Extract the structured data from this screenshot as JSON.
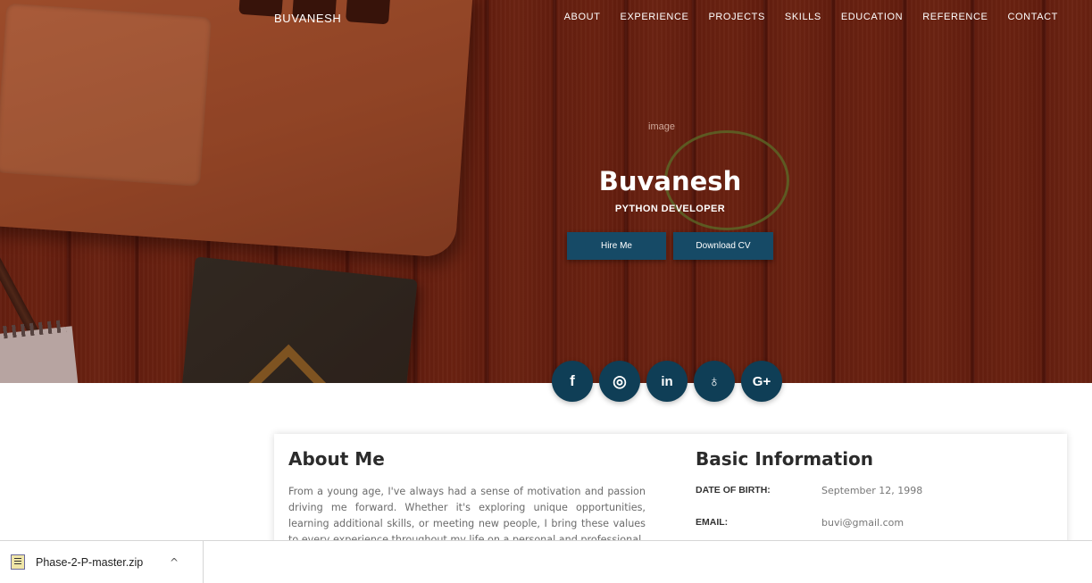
{
  "brand": "BUVANESH",
  "nav": [
    "ABOUT",
    "EXPERIENCE",
    "PROJECTS",
    "SKILLS",
    "EDUCATION",
    "REFERENCE",
    "CONTACT"
  ],
  "hero": {
    "image_alt": "image",
    "name": "Buvanesh",
    "role": "PYTHON DEVELOPER",
    "hire_label": "Hire Me",
    "cv_label": "Download CV"
  },
  "social": [
    {
      "icon": "facebook-icon",
      "glyph": "f"
    },
    {
      "icon": "instagram-icon",
      "glyph": "◎"
    },
    {
      "icon": "linkedin-icon",
      "glyph": "in"
    },
    {
      "icon": "github-icon",
      "glyph": "♁"
    },
    {
      "icon": "google-plus-icon",
      "glyph": "G+"
    }
  ],
  "about": {
    "title": "About Me",
    "text": "From a young age, I've always had a sense of motivation and passion driving me forward. Whether it's exploring unique opportunities, learning additional skills, or meeting new people, I bring these values to every experience throughout my life on a personal and professional"
  },
  "basic": {
    "title": "Basic Information",
    "dob_label": "DATE OF BIRTH:",
    "dob_value": "September 12, 1998",
    "email_label": "EMAIL:",
    "email_value": "buvi@gmail.com"
  },
  "download_bar": {
    "filename": "Phase-2-P-master.zip",
    "chevron": "^"
  },
  "colors": {
    "button_bg": "#164a66",
    "social_bg": "#0f3e56"
  }
}
